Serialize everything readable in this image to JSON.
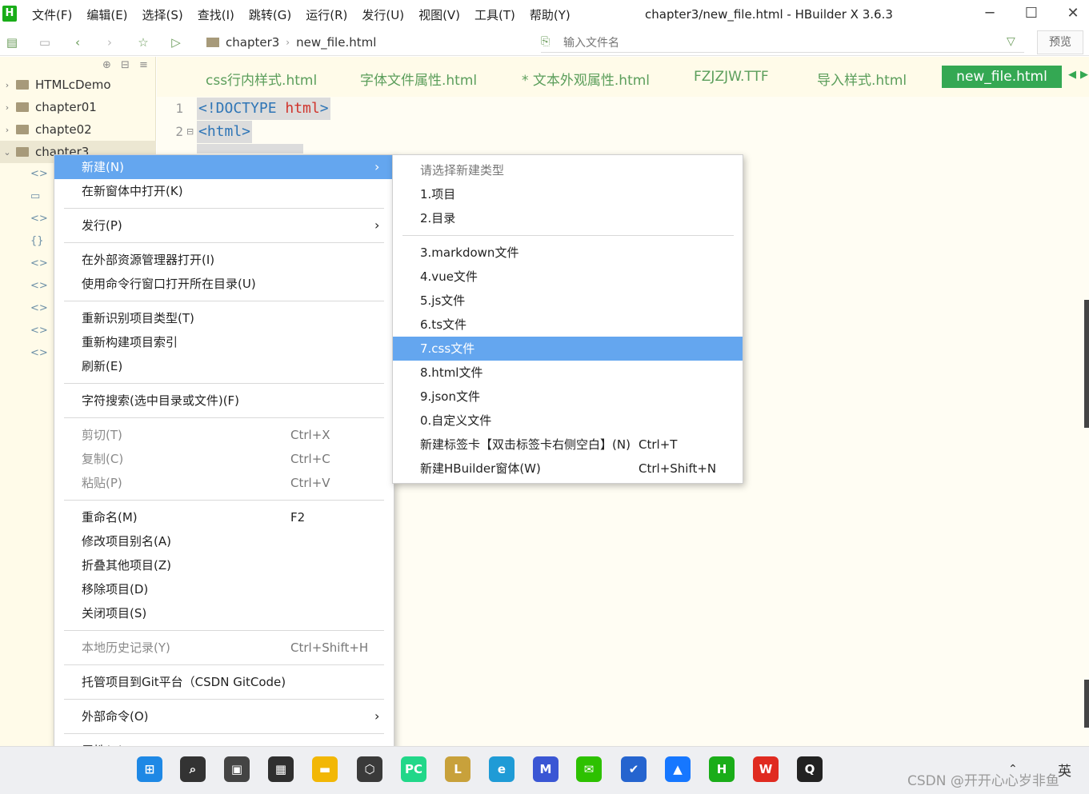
{
  "app": {
    "logo_letter": "H",
    "window_title": "chapter3/new_file.html - HBuilder X 3.6.3",
    "menu": [
      "文件(F)",
      "编辑(E)",
      "选择(S)",
      "查找(I)",
      "跳转(G)",
      "运行(R)",
      "发行(U)",
      "视图(V)",
      "工具(T)",
      "帮助(Y)"
    ]
  },
  "toolbar": {
    "breadcrumb": [
      "chapter3",
      "new_file.html"
    ],
    "file_search_placeholder": "输入文件名",
    "preview_label": "预览"
  },
  "sidebar": {
    "projects": [
      {
        "name": "HTMLcDemo",
        "expanded": false
      },
      {
        "name": "chapter01",
        "expanded": false
      },
      {
        "name": "chapte02",
        "expanded": false
      },
      {
        "name": "chapter3",
        "expanded": true
      }
    ],
    "child_icons": [
      "<>",
      "folder",
      "<>",
      "{}",
      "<>",
      "<>",
      "<>",
      "<>",
      "<>"
    ]
  },
  "tabs": {
    "items": [
      "css行内样式.html",
      "字体文件属性.html",
      "* 文本外观属性.html",
      "FZJZJW.TTF",
      "导入样式.html"
    ],
    "active": "new_file.html"
  },
  "editor": {
    "lines": [
      {
        "no": "1",
        "parts": [
          [
            "tag",
            "<!DOCTYPE "
          ],
          [
            "kw",
            "html"
          ],
          [
            "tag",
            ">"
          ]
        ]
      },
      {
        "no": "2",
        "parts": [
          [
            "tag",
            "<html>"
          ]
        ]
      }
    ]
  },
  "context_menu": {
    "items": [
      {
        "label": "新建(N)",
        "submenu": true,
        "highlight": true
      },
      {
        "label": "在新窗体中打开(K)"
      },
      {
        "sep": true
      },
      {
        "label": "发行(P)",
        "submenu": true
      },
      {
        "sep": true
      },
      {
        "label": "在外部资源管理器打开(I)"
      },
      {
        "label": "使用命令行窗口打开所在目录(U)"
      },
      {
        "sep": true
      },
      {
        "label": "重新识别项目类型(T)"
      },
      {
        "label": "重新构建项目索引"
      },
      {
        "label": "刷新(E)"
      },
      {
        "sep": true
      },
      {
        "label": "字符搜索(选中目录或文件)(F)"
      },
      {
        "sep": true
      },
      {
        "label": "剪切(T)",
        "shortcut": "Ctrl+X",
        "disabled": true
      },
      {
        "label": "复制(C)",
        "shortcut": "Ctrl+C",
        "disabled": true
      },
      {
        "label": "粘贴(P)",
        "shortcut": "Ctrl+V",
        "disabled": true
      },
      {
        "sep": true
      },
      {
        "label": "重命名(M)",
        "shortcut": "F2"
      },
      {
        "label": "修改项目别名(A)"
      },
      {
        "label": "折叠其他项目(Z)"
      },
      {
        "label": "移除项目(D)"
      },
      {
        "label": "关闭项目(S)"
      },
      {
        "sep": true
      },
      {
        "label": "本地历史记录(Y)",
        "shortcut": "Ctrl+Shift+H",
        "disabled": true
      },
      {
        "sep": true
      },
      {
        "label": "托管项目到Git平台（CSDN GitCode)"
      },
      {
        "sep": true
      },
      {
        "label": "外部命令(O)",
        "submenu": true
      },
      {
        "sep": true
      },
      {
        "label": "属性(R)"
      }
    ]
  },
  "submenu": {
    "header": "请选择新建类型",
    "items": [
      {
        "label": "1.项目"
      },
      {
        "label": "2.目录"
      },
      {
        "sep": true
      },
      {
        "label": "3.markdown文件"
      },
      {
        "label": "4.vue文件"
      },
      {
        "label": "5.js文件"
      },
      {
        "label": "6.ts文件"
      },
      {
        "label": "7.css文件",
        "highlight": true
      },
      {
        "label": "8.html文件"
      },
      {
        "label": "9.json文件"
      },
      {
        "label": "0.自定义文件"
      },
      {
        "label": "新建标签卡【双击标签卡右侧空白】(N)",
        "shortcut": "Ctrl+T"
      },
      {
        "label": "新建HBuilder窗体(W)",
        "shortcut": "Ctrl+Shift+N"
      }
    ]
  },
  "taskbar": {
    "apps": [
      {
        "name": "windows-start",
        "color": "#1e88e5",
        "glyph": "⊞"
      },
      {
        "name": "search",
        "color": "#333333",
        "glyph": "⌕"
      },
      {
        "name": "task-view",
        "color": "#444444",
        "glyph": "▣"
      },
      {
        "name": "store",
        "color": "#2f2f2f",
        "glyph": "▦"
      },
      {
        "name": "explorer",
        "color": "#f2b705",
        "glyph": "▬"
      },
      {
        "name": "terminal",
        "color": "#3a3a3a",
        "glyph": "⬡"
      },
      {
        "name": "pycharm",
        "color": "#21d789",
        "glyph": "PC"
      },
      {
        "name": "league",
        "color": "#c8a13b",
        "glyph": "L"
      },
      {
        "name": "edge",
        "color": "#1f9bd6",
        "glyph": "e"
      },
      {
        "name": "visual-studio",
        "color": "#3a56d4",
        "glyph": "M"
      },
      {
        "name": "wechat",
        "color": "#2dc100",
        "glyph": "✉"
      },
      {
        "name": "todo",
        "color": "#2564cf",
        "glyph": "✔"
      },
      {
        "name": "lanhu",
        "color": "#1677ff",
        "glyph": "▲"
      },
      {
        "name": "hbuilder",
        "color": "#1aad19",
        "glyph": "H"
      },
      {
        "name": "wps",
        "color": "#e02b20",
        "glyph": "W"
      },
      {
        "name": "qq",
        "color": "#222222",
        "glyph": "Q"
      }
    ],
    "ime": "英"
  },
  "watermark": "CSDN @开开心心岁非鱼"
}
